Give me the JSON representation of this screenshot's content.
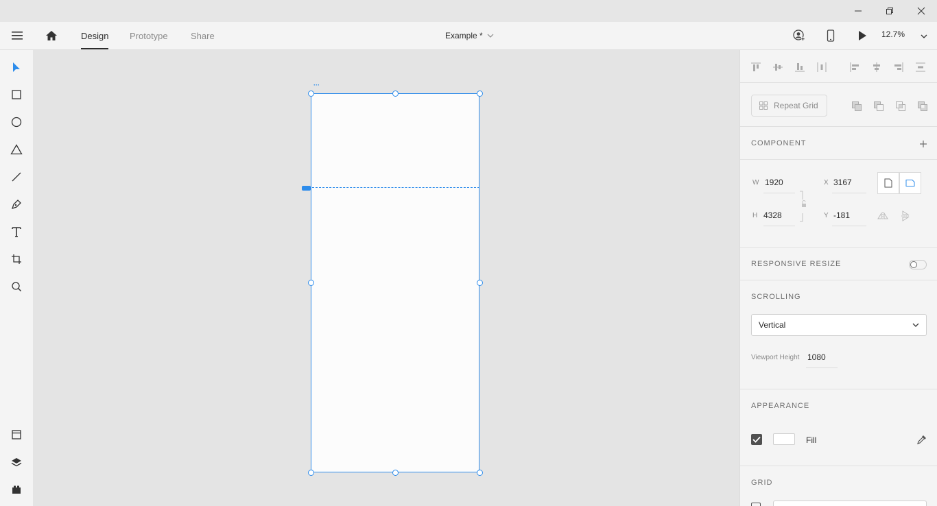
{
  "header": {
    "tabs": [
      {
        "label": "Design",
        "active": true
      },
      {
        "label": "Prototype",
        "active": false
      },
      {
        "label": "Share",
        "active": false
      }
    ],
    "document_title": "Example *",
    "zoom": "12.7%"
  },
  "toolbar": {
    "tools": [
      "select-tool",
      "rectangle-tool",
      "ellipse-tool",
      "polygon-tool",
      "line-tool",
      "pen-tool",
      "text-tool",
      "artboard-tool",
      "zoom-tool"
    ],
    "bottom_tools": [
      "assets",
      "layers",
      "plugins"
    ],
    "active_tool": "select-tool"
  },
  "panel": {
    "repeat_grid_label": "Repeat Grid",
    "component_heading": "COMPONENT",
    "w_label": "W",
    "w_value": "1920",
    "h_label": "H",
    "h_value": "4328",
    "x_label": "X",
    "x_value": "3167",
    "y_label": "Y",
    "y_value": "-181",
    "responsive_heading": "RESPONSIVE RESIZE",
    "responsive_enabled": false,
    "scrolling_heading": "SCROLLING",
    "scrolling_value": "Vertical",
    "viewport_label": "Viewport Height",
    "viewport_value": "1080",
    "appearance_heading": "APPEARANCE",
    "fill_label": "Fill",
    "fill_checked": true,
    "fill_color": "#ffffff",
    "grid_heading": "GRID"
  },
  "colors": {
    "accent": "#2d8ceb",
    "panel_bg": "#f4f4f4",
    "canvas_bg": "#e4e4e4"
  }
}
